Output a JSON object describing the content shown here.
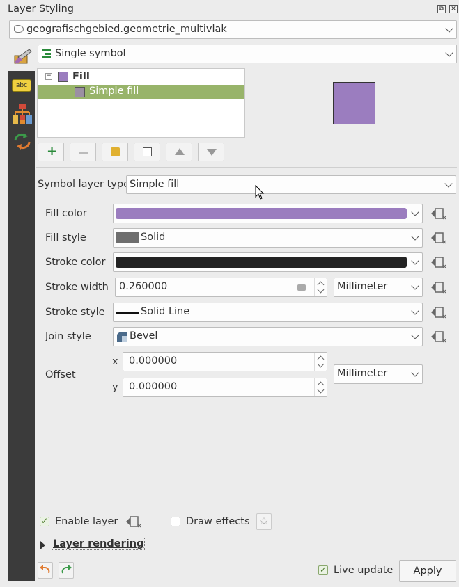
{
  "window": {
    "title": "Layer Styling"
  },
  "layer_select": {
    "value": "geografischgebied.geometrie_multivlak"
  },
  "renderer_select": {
    "value": "Single symbol"
  },
  "symbol_tree": {
    "items": [
      {
        "label": "Fill",
        "color": "#9b7dbf"
      },
      {
        "label": "Simple fill",
        "color": "#9b8fa3"
      }
    ]
  },
  "preview": {
    "fill": "#9b7dbf"
  },
  "symbol_layer_type": {
    "label": "Symbol layer type",
    "value": "Simple fill"
  },
  "props": {
    "fill_color": {
      "label": "Fill color",
      "value": "#9b7dbf"
    },
    "fill_style": {
      "label": "Fill style",
      "value": "Solid"
    },
    "stroke_color": {
      "label": "Stroke color",
      "value": "#232323"
    },
    "stroke_width": {
      "label": "Stroke width",
      "value": "0.260000",
      "unit": "Millimeter"
    },
    "stroke_style": {
      "label": "Stroke style",
      "value": "Solid Line"
    },
    "join_style": {
      "label": "Join style",
      "value": "Bevel"
    },
    "offset": {
      "label": "Offset",
      "x_label": "x",
      "x": "0.000000",
      "y_label": "y",
      "y": "0.000000",
      "unit": "Millimeter"
    }
  },
  "footer": {
    "enable_layer": "Enable layer",
    "draw_effects": "Draw effects",
    "layer_rendering": "Layer rendering",
    "live_update": "Live update",
    "apply": "Apply"
  },
  "colors": {
    "selection": "#98b46a",
    "sidebar": "#3b3b3b"
  }
}
